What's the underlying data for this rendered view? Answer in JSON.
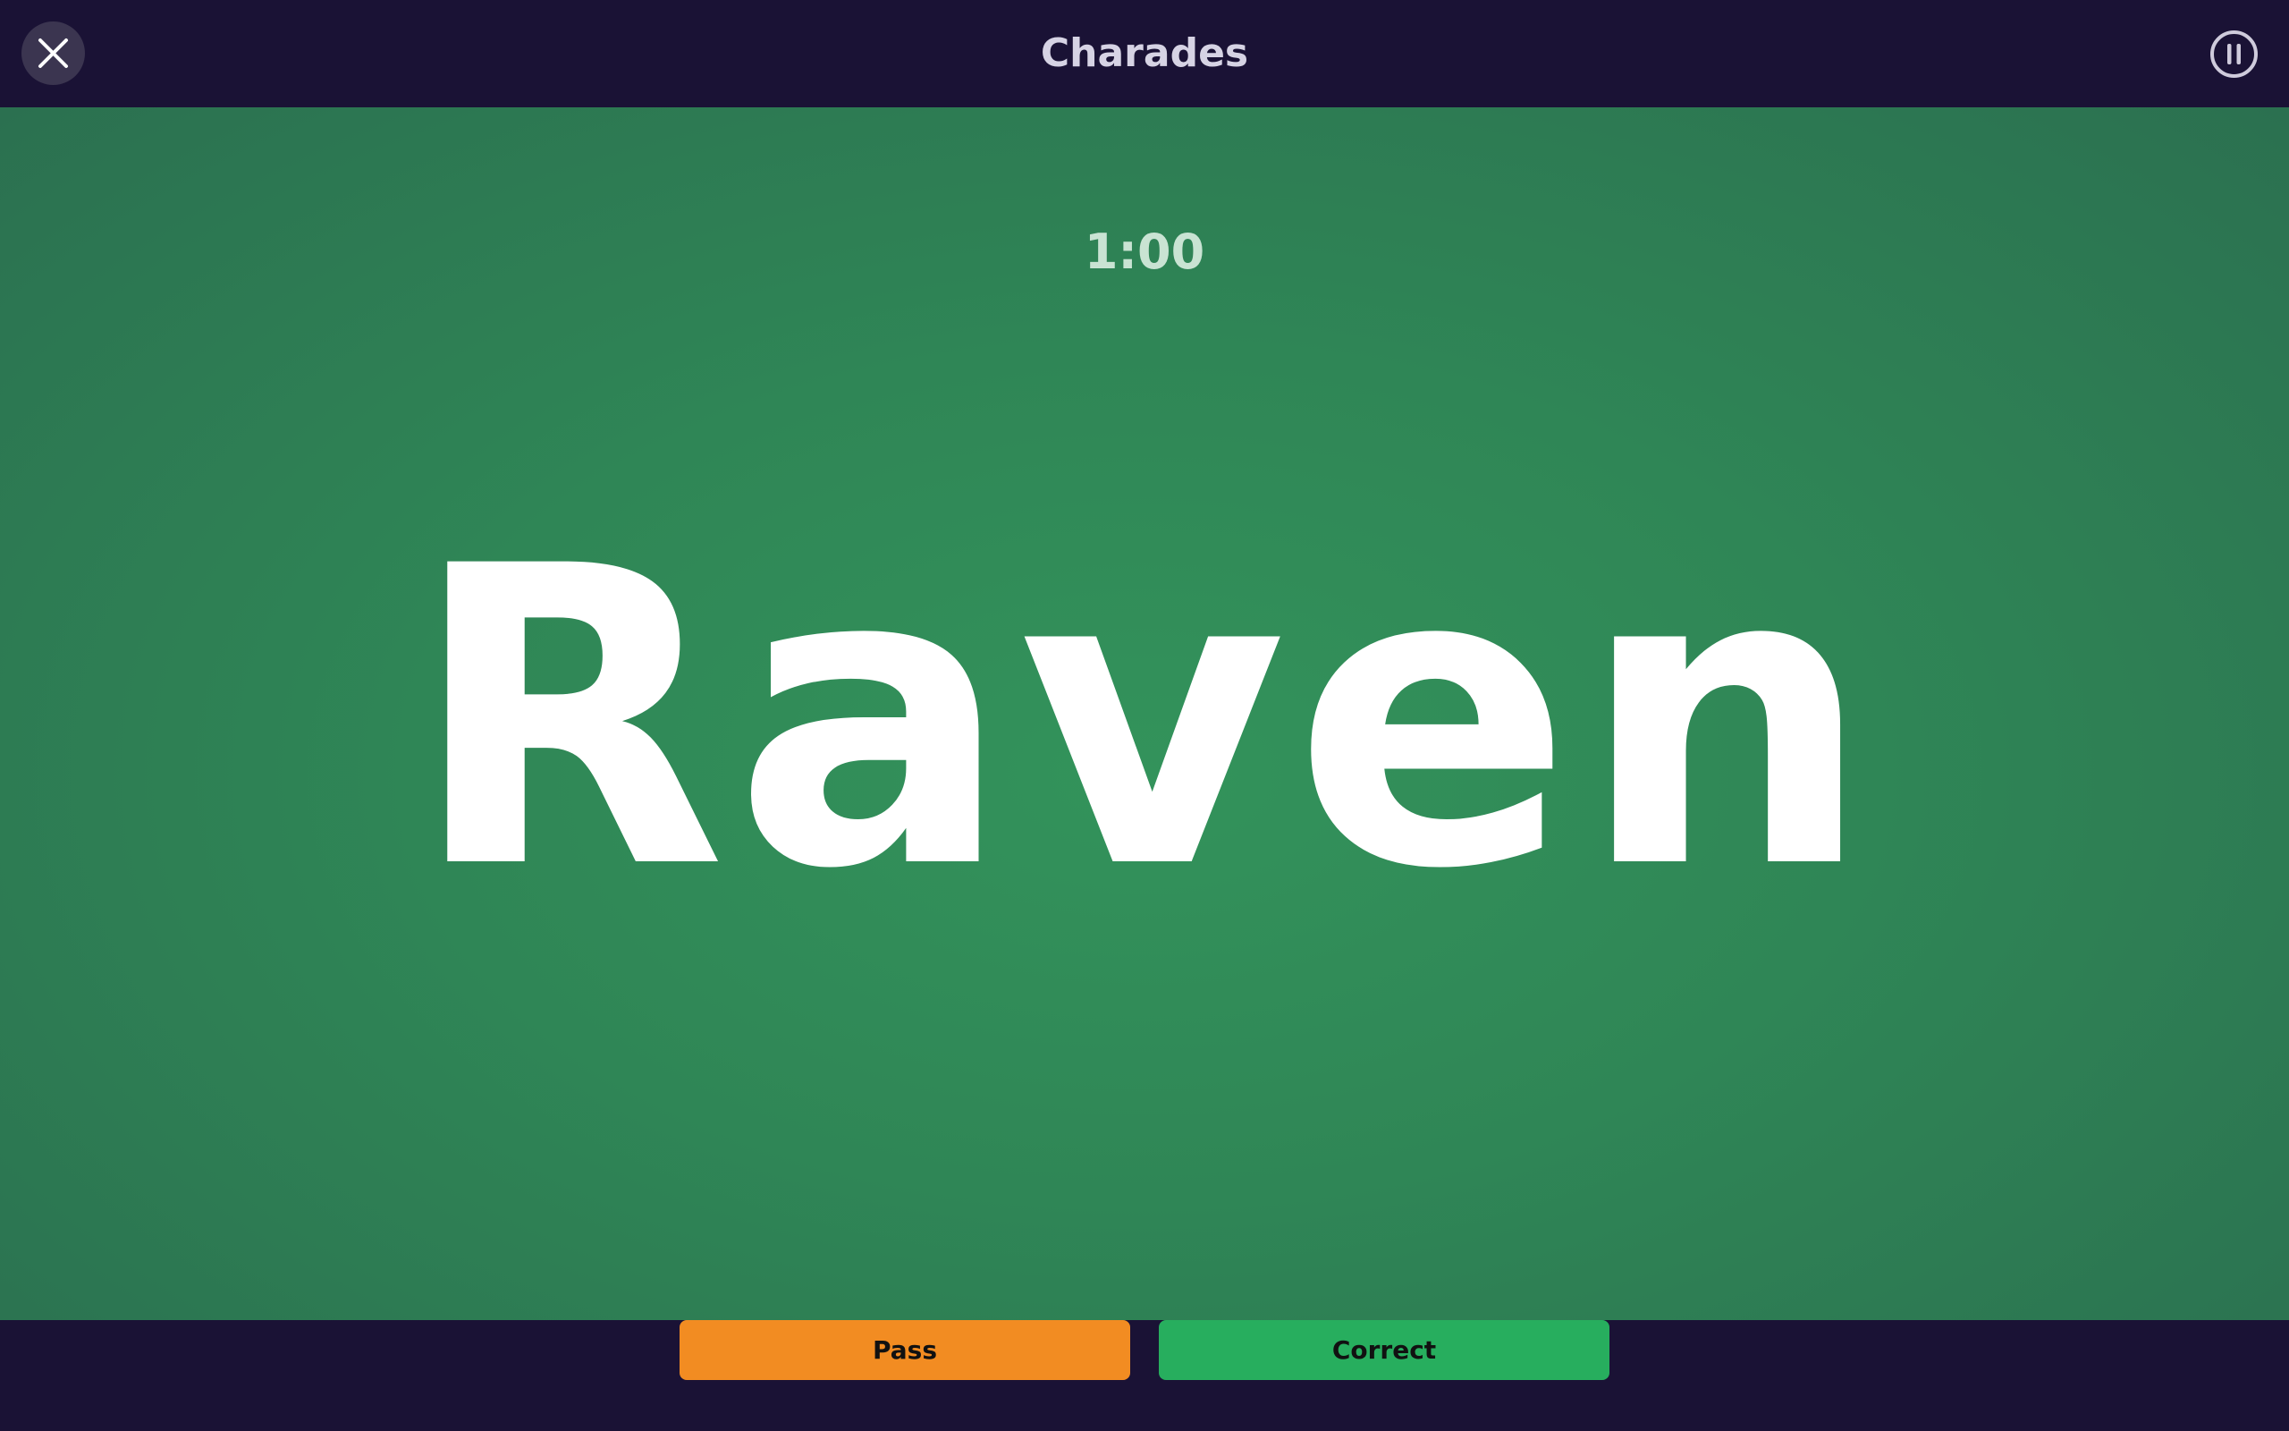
{
  "header": {
    "title": "Charades",
    "close_icon": "close-icon",
    "pause_icon": "pause-icon"
  },
  "game": {
    "timer": "1:00",
    "word": "Raven"
  },
  "actions": {
    "pass_label": "Pass",
    "correct_label": "Correct"
  },
  "colors": {
    "bar_background": "#1a1235",
    "stage_green": "#33935b",
    "pass": "#f28c22",
    "correct": "#27ae5e"
  }
}
